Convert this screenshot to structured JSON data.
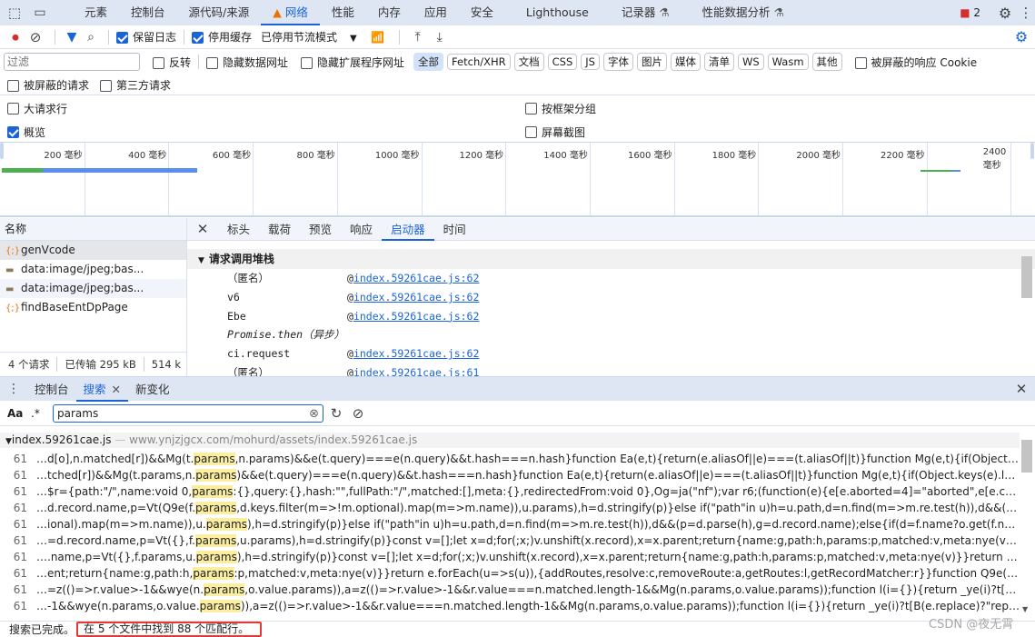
{
  "top_tabs": [
    "元素",
    "控制台",
    "源代码/来源",
    "网络",
    "性能",
    "内存",
    "应用",
    "安全",
    "Lighthouse",
    "记录器",
    "性能数据分析"
  ],
  "active_tab": "网络",
  "issues_count": "2",
  "toolbar": {
    "preserve_log": "保留日志",
    "disable_cache": "停用缓存",
    "throttling": "已停用节流模式"
  },
  "filter": {
    "placeholder": "过滤",
    "invert": "反转",
    "hide_data_urls": "隐藏数据网址",
    "hide_ext_urls": "隐藏扩展程序网址",
    "types": [
      "全部",
      "Fetch/XHR",
      "文档",
      "CSS",
      "JS",
      "字体",
      "图片",
      "媒体",
      "清单",
      "WS",
      "Wasm",
      "其他"
    ],
    "blocked_cookies": "被屏蔽的响应 Cookie",
    "blocked_requests": "被屏蔽的请求",
    "third_party": "第三方请求"
  },
  "settings": {
    "big_rows": "大请求行",
    "overview": "概览",
    "group_by_frame": "按框架分组",
    "screenshots": "屏幕截图"
  },
  "timeline": {
    "ticks": [
      "200 毫秒",
      "400 毫秒",
      "600 毫秒",
      "800 毫秒",
      "1000 毫秒",
      "1200 毫秒",
      "1400 毫秒",
      "1600 毫秒",
      "1800 毫秒",
      "2000 毫秒",
      "2200 毫秒",
      "2400 毫秒"
    ]
  },
  "requests": {
    "header": "名称",
    "items": [
      "genVcode",
      "data:image/jpeg;bas...",
      "data:image/jpeg;bas...",
      "findBaseEntDpPage"
    ],
    "summary": {
      "count": "4 个请求",
      "transferred": "已传输 295 kB",
      "resources": "514 k"
    }
  },
  "detail": {
    "tabs": [
      "标头",
      "载荷",
      "预览",
      "响应",
      "启动器",
      "时间"
    ],
    "active": "启动器",
    "section": "请求调用堆栈",
    "stack": [
      {
        "fn": "（匿名）",
        "loc": "index.59261cae.js:62"
      },
      {
        "fn": "v6",
        "loc": "index.59261cae.js:62"
      },
      {
        "fn": "Ebe",
        "loc": "index.59261cae.js:62"
      },
      {
        "fn": "Promise.then（异步）",
        "loc": ""
      },
      {
        "fn": "ci.request",
        "loc": "index.59261cae.js:62"
      },
      {
        "fn": "（匿名）",
        "loc": "index.59261cae.js:61"
      }
    ]
  },
  "drawer": {
    "tabs": [
      "控制台",
      "搜索",
      "新变化"
    ],
    "active": "搜索"
  },
  "search": {
    "case_label": "Aa",
    "regex_label": ".*",
    "query": "params",
    "file": "index.59261cae.js",
    "file_url": "www.ynjzjgcx.com/mohurd/assets/index.59261cae.js",
    "results": [
      {
        "line": "61",
        "pre": "…d[o],n.matched[r])&&Mg(t.",
        "match": "params",
        "post": ",n.params)&&e(t.query)===e(n.query)&&t.hash===n.hash}function Ea(e,t){return(e.aliasOf||e)===(t.aliasOf||t)}function Mg(e,t){if(Object.keys(e).length!==Object.keys(t)...."
      },
      {
        "line": "61",
        "pre": "…tched[r])&&Mg(t.params,n.",
        "match": "params",
        "post": ")&&e(t.query)===e(n.query)&&t.hash===n.hash}function Ea(e,t){return(e.aliasOf||e)===(t.aliasOf||t)}function Mg(e,t){if(Object.keys(e).length!==Object.keys(t).length)re…"
      },
      {
        "line": "61",
        "pre": "…$r={path:\"/\",name:void 0,",
        "match": "params",
        "post": ":{},query:{},hash:\"\",fullPath:\"/\",matched:[],meta:{},redirectedFrom:void 0},Og=ja(\"nf\");var r6;(function(e){e[e.aborted=4]=\"aborted\",e[e.cancelled=8]=\"cancelled\",e[e.duplicat…"
      },
      {
        "line": "61",
        "pre": "…d.record.name,p=Vt(Q9e(f.",
        "match": "params",
        "post": ",d.keys.filter(m=>!m.optional).map(m=>m.name)),u.params),h=d.stringify(p)}else if(\"path\"in u)h=u.path,d=n.find(m=>m.re.test(h)),d&&(p=d.parse(h),g=d.record.name);…"
      },
      {
        "line": "61",
        "pre": "…ional).map(m=>m.name)),u.",
        "match": "params",
        "post": "),h=d.stringify(p)}else if(\"path\"in u)h=u.path,d=n.find(m=>m.re.test(h)),d&&(p=d.parse(h),g=d.record.name);else{if(d=f.name?o.get(f.name):n.find(m=>m.re.test(f.path)…"
      },
      {
        "line": "61",
        "pre": "…=d.record.name,p=Vt({},f.",
        "match": "params",
        "post": ",u.params),h=d.stringify(p)}const v=[];let x=d;for(;x;)v.unshift(x.record),x=x.parent;return{name:g,path:h,params:p,matched:v,meta:nye(v)}}return e.forEach(u=>s(u)),{addRo…"
      },
      {
        "line": "61",
        "pre": "….name,p=Vt({},f.params,u.",
        "match": "params",
        "post": "),h=d.stringify(p)}const v=[];let x=d;for(;x;)v.unshift(x.record),x=x.parent;return{name:g,path:h,params:p,matched:v,meta:nye(v)}}return e.forEach(u=>s(u)),{addRoute:s,resol…"
      },
      {
        "line": "61",
        "pre": "…ent;return{name:g,path:h,",
        "match": "params",
        "post": ":p,matched:v,meta:nye(v)}}return e.forEach(u=>s(u)),{addRoutes,resolve:c,removeRoute:a,getRoutes:l,getRecordMatcher:r}}function Q9e(e,t){const n={};for(const o of t)o in…"
      },
      {
        "line": "61",
        "pre": "…=z(()=>r.value>-1&&wye(n.",
        "match": "params",
        "post": ",o.value.params)),a=z(()=>r.value>-1&&r.value===n.matched.length-1&&Mg(n.params,o.value.params));function l(i={}){return _ye(i)?t[B(e.replace)?\"replace\":\"push\"](B(…"
      },
      {
        "line": "61",
        "pre": "…-1&&wye(n.params,o.value.",
        "match": "params",
        "post": ")),a=z(()=>r.value>-1&&r.value===n.matched.length-1&&Mg(n.params,o.value.params));function l(i={}){return _ye(i)?t[B(e.replace)?\"replace\":\"push\"](B(e.to)).catch($l):P…"
      }
    ],
    "status": "搜索已完成。",
    "status_detail": "在 5 个文件中找到 88 个匹配行。"
  },
  "watermark": "CSDN @夜无霄",
  "colors": {
    "accent": "#1a64d8",
    "highlight": "#fbeea0",
    "status_box": "#e53935"
  }
}
